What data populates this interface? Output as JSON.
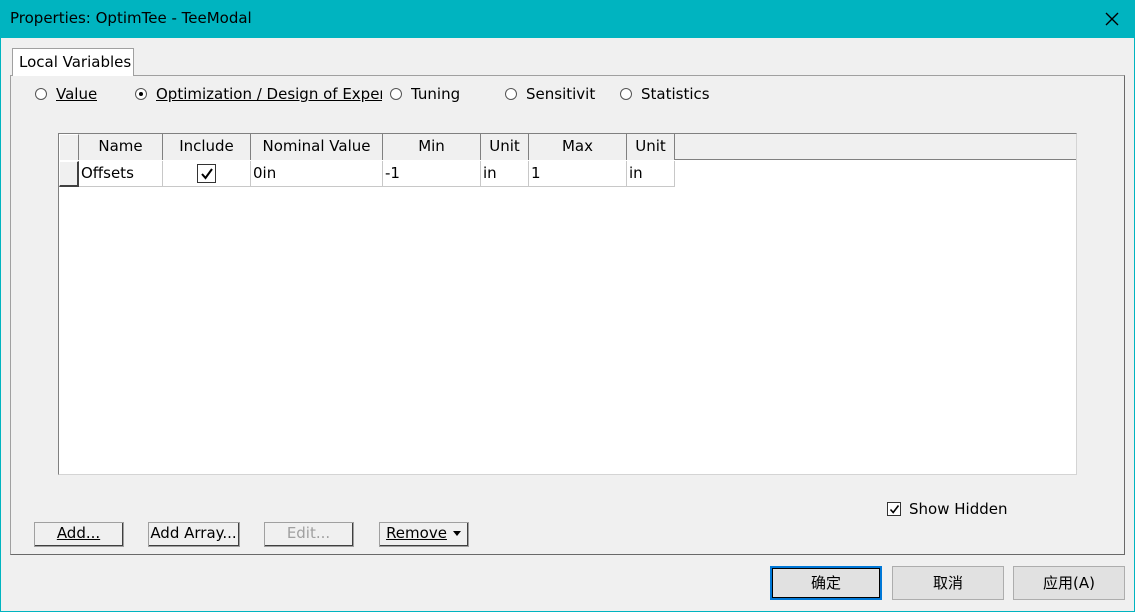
{
  "window": {
    "title": "Properties: OptimTee - TeeModal",
    "close_icon": "close-icon"
  },
  "tabs": [
    {
      "label": "Local Variables",
      "active": true
    }
  ],
  "modes": {
    "value_label": "Value",
    "optimization_label": "Optimization / Design of Exper",
    "tuning_label": "Tuning",
    "sensitivity_label": "Sensitivity",
    "statistics_label": "Statistics",
    "selected": "Optimization / Design of Exper"
  },
  "table": {
    "columns": [
      "Name",
      "Include",
      "Nominal Value",
      "Min",
      "Unit",
      "Max",
      "Unit"
    ],
    "rows": [
      {
        "name": "Offsets",
        "include": true,
        "nominal": "0in",
        "min": "-1",
        "min_unit": "in",
        "max": "1",
        "max_unit": "in"
      }
    ]
  },
  "options": {
    "show_hidden_label": "Show Hidden",
    "show_hidden_checked": true
  },
  "buttons": {
    "add": "Add...",
    "add_array": "Add Array...",
    "edit": "Edit...",
    "remove": "Remove",
    "ok": "确定",
    "cancel": "取消",
    "apply": "应用(A)"
  },
  "colors": {
    "titlebar": "#00b4c0",
    "focus": "#0078d7"
  }
}
